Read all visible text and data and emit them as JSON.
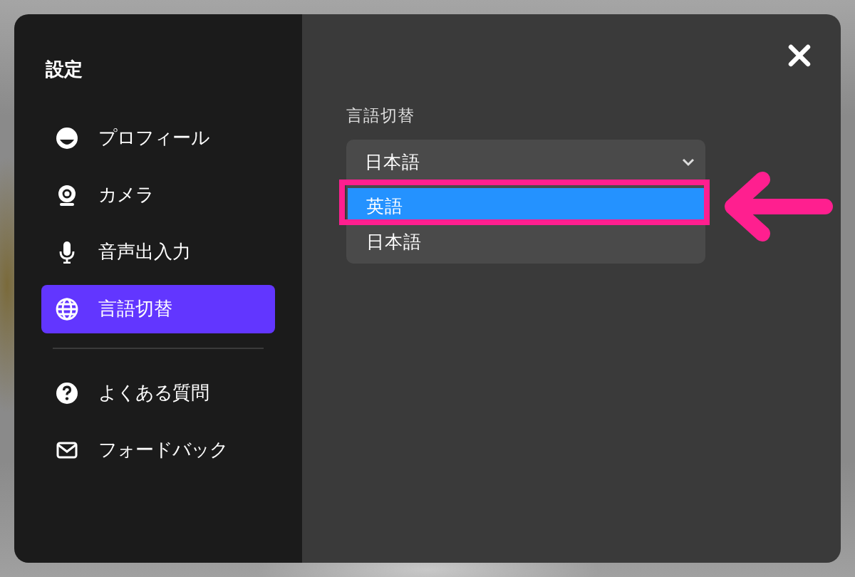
{
  "title": "設定",
  "menu": [
    {
      "label": "プロフィール",
      "selected": false
    },
    {
      "label": "カメラ",
      "selected": false
    },
    {
      "label": "音声出入力",
      "selected": false
    },
    {
      "label": "言語切替",
      "selected": true
    }
  ],
  "menu_secondary": [
    {
      "label": "よくある質問",
      "selected": false
    },
    {
      "label": "フォードバック",
      "selected": false
    }
  ],
  "section_label": "言語切替",
  "language_select": {
    "value": "日本語",
    "expanded": true,
    "options": [
      {
        "label": "英語",
        "highlighted": true
      },
      {
        "label": "日本語",
        "highlighted": false
      }
    ]
  }
}
